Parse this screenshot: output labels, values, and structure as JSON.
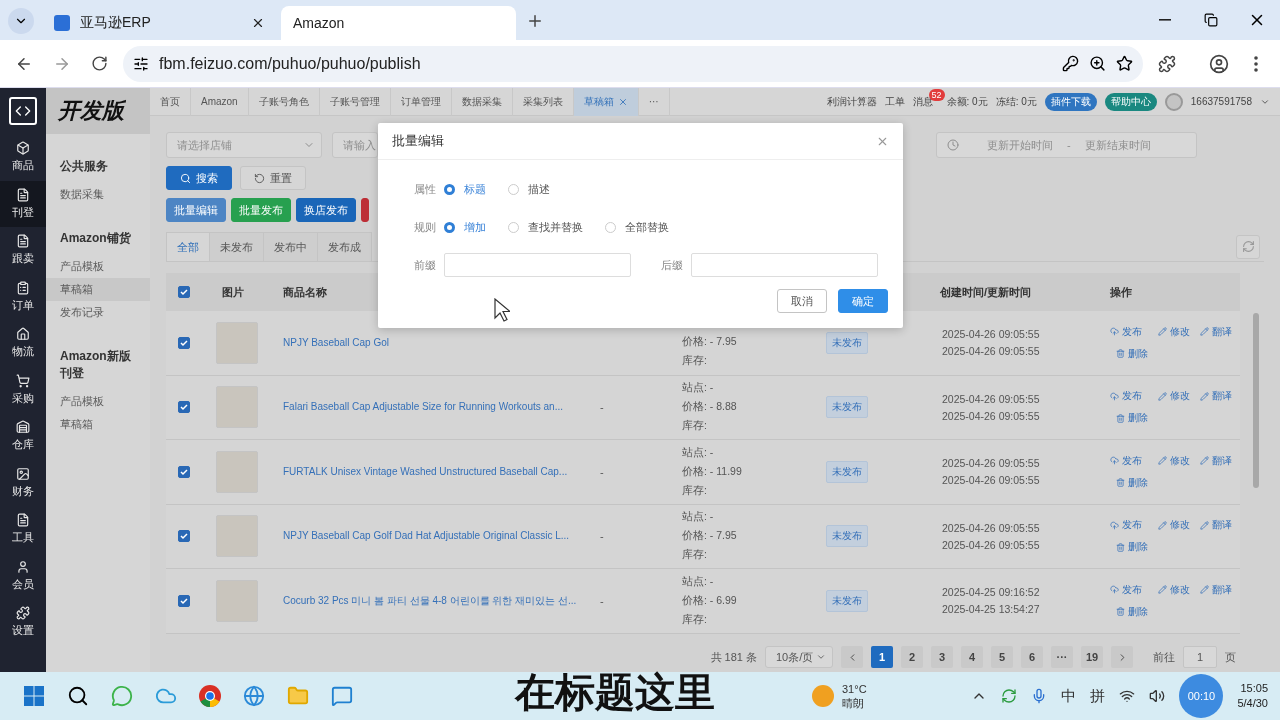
{
  "browser": {
    "tabs": [
      {
        "label": "亚马逊ERP",
        "selected": false,
        "closable": true
      },
      {
        "label": "Amazon",
        "selected": true,
        "closable": false
      }
    ],
    "url": "fbm.feizuo.com/puhuo/puhuo/publish"
  },
  "app": {
    "brand": "开发版"
  },
  "rail": [
    {
      "label": "商品",
      "selected": false
    },
    {
      "label": "刊登",
      "selected": true
    },
    {
      "label": "跟卖",
      "selected": false
    },
    {
      "label": "订单",
      "selected": false
    },
    {
      "label": "物流",
      "selected": false
    },
    {
      "label": "采购",
      "selected": false
    },
    {
      "label": "仓库",
      "selected": false
    },
    {
      "label": "财务",
      "selected": false
    },
    {
      "label": "工具",
      "selected": false
    },
    {
      "label": "会员",
      "selected": false
    },
    {
      "label": "设置",
      "selected": false
    }
  ],
  "sidebar": {
    "groups": [
      {
        "title": "公共服务",
        "items": [
          {
            "label": "数据采集",
            "selected": false
          }
        ]
      },
      {
        "title": "Amazon铺货",
        "items": [
          {
            "label": "产品模板",
            "selected": false
          },
          {
            "label": "草稿箱",
            "selected": true
          },
          {
            "label": "发布记录",
            "selected": false
          }
        ]
      },
      {
        "title": "Amazon新版刊登",
        "items": [
          {
            "label": "产品模板",
            "selected": false
          },
          {
            "label": "草稿箱",
            "selected": false
          }
        ]
      }
    ]
  },
  "nav_tabs": [
    {
      "label": "首页",
      "selected": false,
      "closable": false
    },
    {
      "label": "Amazon",
      "selected": false,
      "closable": false
    },
    {
      "label": "子账号角色",
      "selected": false,
      "closable": false
    },
    {
      "label": "子账号管理",
      "selected": false,
      "closable": false
    },
    {
      "label": "订单管理",
      "selected": false,
      "closable": false
    },
    {
      "label": "数据采集",
      "selected": false,
      "closable": false
    },
    {
      "label": "采集列表",
      "selected": false,
      "closable": false
    },
    {
      "label": "草稿箱",
      "selected": true,
      "closable": true
    }
  ],
  "nav_more": "···",
  "header": {
    "links": [
      "利润计算器",
      "工单"
    ],
    "messages": {
      "label": "消息",
      "badge": "52"
    },
    "balance": "余额: 0元",
    "frozen": "冻结: 0元",
    "buttons": [
      {
        "label": "插件下载",
        "kind": "primary"
      },
      {
        "label": "帮助中心",
        "kind": "success"
      }
    ],
    "user": "16637591758"
  },
  "filters": {
    "shop_placeholder": "请选择店铺",
    "keyword_placeholder": "请输入",
    "date_start": "更新开始时间",
    "date_sep": "-",
    "date_end": "更新结束时间"
  },
  "toolbar": {
    "search": "搜索",
    "reset": "重置"
  },
  "bulk_actions": [
    {
      "label": "批量编辑",
      "color": "#4d85c4"
    },
    {
      "label": "批量发布",
      "color": "#27a04f"
    },
    {
      "label": "换店发布",
      "color": "#1a66b8"
    },
    {
      "color": "#bd2e36"
    }
  ],
  "status_tabs": [
    {
      "label": "全部",
      "selected": true
    },
    {
      "label": "未发布",
      "selected": false
    },
    {
      "label": "发布中",
      "selected": false
    },
    {
      "label": "发布成",
      "selected": false
    }
  ],
  "table": {
    "all_checked": true,
    "columns": {
      "image": "图片",
      "name": "商品名称",
      "time": "创建时间/更新时间",
      "ops": "操作"
    },
    "rows": [
      {
        "checked": true,
        "name": "NPJY Baseball Cap Gol",
        "price": "价格: - 7.95",
        "stock": "库存:",
        "status": "未发布",
        "created": "2025-04-26 09:05:55",
        "updated": "2025-04-26 09:05:55",
        "actions": [
          {
            "label": "发布",
            "kind": "publish"
          },
          {
            "label": "修改",
            "kind": "edit"
          },
          {
            "label": "翻译",
            "kind": "translate"
          },
          {
            "label": "删除",
            "kind": "delete"
          }
        ]
      },
      {
        "checked": true,
        "name": "Falari Baseball Cap Adjustable Size for Running Workouts an...",
        "dash": "-",
        "site": "站点: -",
        "price": "价格: - 8.88",
        "stock": "库存:",
        "status": "未发布",
        "created": "2025-04-26 09:05:55",
        "updated": "2025-04-26 09:05:55",
        "actions": [
          {
            "label": "发布",
            "kind": "publish"
          },
          {
            "label": "修改",
            "kind": "edit"
          },
          {
            "label": "翻译",
            "kind": "translate"
          },
          {
            "label": "删除",
            "kind": "delete"
          }
        ]
      },
      {
        "checked": true,
        "name": "FURTALK Unisex Vintage Washed Unstructured Baseball Cap...",
        "dash": "-",
        "site": "站点: -",
        "price": "价格: - 11.99",
        "stock": "库存:",
        "status": "未发布",
        "created": "2025-04-26 09:05:55",
        "updated": "2025-04-26 09:05:55",
        "actions": [
          {
            "label": "发布",
            "kind": "publish"
          },
          {
            "label": "修改",
            "kind": "edit"
          },
          {
            "label": "翻译",
            "kind": "translate"
          },
          {
            "label": "删除",
            "kind": "delete"
          }
        ]
      },
      {
        "checked": true,
        "name": "NPJY Baseball Cap Golf Dad Hat Adjustable Original Classic L...",
        "dash": "-",
        "site": "站点: -",
        "price": "价格: - 7.95",
        "stock": "库存:",
        "status": "未发布",
        "created": "2025-04-26 09:05:55",
        "updated": "2025-04-26 09:05:55",
        "actions": [
          {
            "label": "发布",
            "kind": "publish"
          },
          {
            "label": "修改",
            "kind": "edit"
          },
          {
            "label": "翻译",
            "kind": "translate"
          },
          {
            "label": "删除",
            "kind": "delete"
          }
        ]
      },
      {
        "checked": true,
        "name": "Cocurb 32 Pcs 미니 봄 파티 선물 4-8 어린이를 위한 재미있는 선...",
        "dash": "-",
        "site": "站点: -",
        "price": "价格: - 6.99",
        "stock": "库存:",
        "status": "未发布",
        "created": "2025-04-25 09:16:52",
        "updated": "2025-04-25 13:54:27",
        "actions": [
          {
            "label": "发布",
            "kind": "publish"
          },
          {
            "label": "修改",
            "kind": "edit"
          },
          {
            "label": "翻译",
            "kind": "translate"
          },
          {
            "label": "删除",
            "kind": "delete"
          }
        ]
      }
    ]
  },
  "pagination": {
    "total": "共 181 条",
    "page_size": "10条/页",
    "pages": [
      {
        "label": "1",
        "selected": true
      },
      {
        "label": "2",
        "selected": false
      },
      {
        "label": "3",
        "selected": false
      },
      {
        "label": "4",
        "selected": false
      },
      {
        "label": "5",
        "selected": false
      },
      {
        "label": "6",
        "selected": false
      },
      {
        "label": "···",
        "selected": false
      },
      {
        "label": "19",
        "selected": false
      }
    ],
    "goto_label": "前往",
    "goto_value": "1",
    "goto_suffix": "页"
  },
  "modal": {
    "title": "批量编辑",
    "fields": [
      {
        "kind": "radio",
        "label": "属性",
        "options": [
          {
            "label": "标题",
            "selected": true
          },
          {
            "label": "描述",
            "selected": false
          }
        ]
      },
      {
        "kind": "radio",
        "label": "规则",
        "options": [
          {
            "label": "增加",
            "selected": true
          },
          {
            "label": "查找并替换",
            "selected": false
          },
          {
            "label": "全部替换",
            "selected": false
          }
        ]
      },
      {
        "kind": "inputs",
        "inputs": [
          {
            "label": "前缀"
          },
          {
            "label": "后缀"
          }
        ]
      }
    ],
    "buttons": [
      {
        "label": "取消",
        "kind": "default"
      },
      {
        "label": "确定",
        "kind": "primary"
      }
    ]
  },
  "taskbar": {
    "weather": {
      "temp": "31°C",
      "text": "晴朗"
    },
    "ime": [
      "中",
      "拼"
    ],
    "recorder": "00:10",
    "time": "15:05",
    "date": "5/4/30"
  },
  "caption": "在标题这里"
}
